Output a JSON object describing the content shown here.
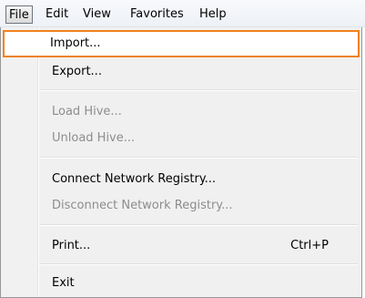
{
  "menubar": {
    "items": [
      {
        "label": "File"
      },
      {
        "label": "Edit"
      },
      {
        "label": "View"
      },
      {
        "label": "Favorites"
      },
      {
        "label": "Help"
      }
    ]
  },
  "file_menu": {
    "items": [
      {
        "label": "Import...",
        "enabled": true,
        "highlighted": true
      },
      {
        "label": "Export...",
        "enabled": true
      },
      {
        "label": "Load Hive...",
        "enabled": false
      },
      {
        "label": "Unload Hive...",
        "enabled": false
      },
      {
        "label": "Connect Network Registry...",
        "enabled": true
      },
      {
        "label": "Disconnect Network Registry...",
        "enabled": false
      },
      {
        "label": "Print...",
        "enabled": true,
        "shortcut": "Ctrl+P"
      },
      {
        "label": "Exit",
        "enabled": true
      }
    ]
  },
  "colors": {
    "highlight_border": "#f0821e",
    "disabled_text": "#8d8d8d"
  }
}
